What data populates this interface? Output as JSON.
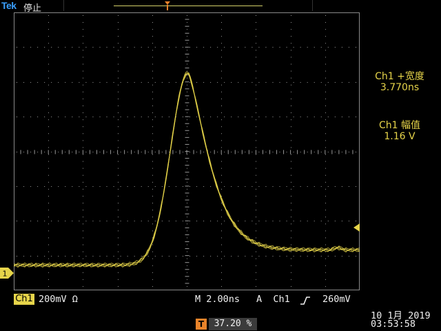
{
  "header": {
    "brand": "Tek",
    "run_state": "停止"
  },
  "screen": {
    "trigger_marker": "T",
    "channel_marker": "1"
  },
  "measurements": [
    {
      "label": "Ch1 +宽度",
      "value": "3.770ns"
    },
    {
      "label": "Ch1 幅值",
      "value": "1.16 V"
    }
  ],
  "status": {
    "channel": "Ch1",
    "vertical_scale": "200mV Ω",
    "horizontal": "M 2.00ns",
    "trigger_prefix": "A",
    "trigger_source": "Ch1",
    "trigger_level": "260mV",
    "trigger_position_icon": "T",
    "trigger_position": "37.20 %",
    "date": "10 1月  2019",
    "time": "03:53:58"
  },
  "colors": {
    "trace": "#e6d44a",
    "brand": "#3aa0ff",
    "trigger": "#e8832a"
  },
  "icons": [
    "trigger-position-icon",
    "channel1-ground-icon",
    "trigger-level-icon",
    "rising-edge-icon"
  ]
}
